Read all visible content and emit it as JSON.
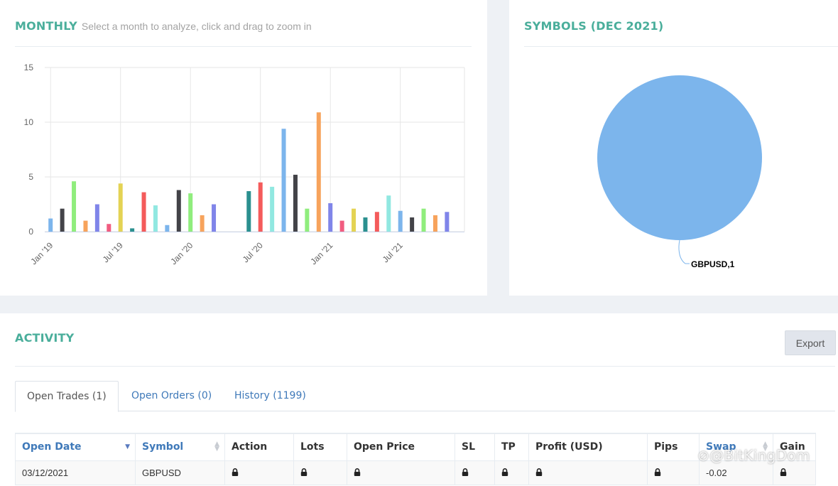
{
  "monthly": {
    "title": "MONTHLY",
    "subtitle": "Select a month to analyze, click and drag to zoom in"
  },
  "symbols": {
    "title": "SYMBOLS (DEC 2021)"
  },
  "activity": {
    "title": "ACTIVITY",
    "export_label": "Export",
    "tabs": [
      "Open Trades (1)",
      "Open Orders (0)",
      "History (1199)"
    ],
    "columns": [
      "Open Date",
      "Symbol",
      "Action",
      "Lots",
      "Open Price",
      "SL",
      "TP",
      "Profit (USD)",
      "Pips",
      "Swap",
      "Gain"
    ],
    "rows": [
      {
        "open_date": "03/12/2021",
        "symbol": "GBPUSD",
        "swap": "-0.02"
      }
    ],
    "locked_icon": "lock-icon"
  },
  "watermark": "@BitKingDom",
  "chart_data": [
    {
      "type": "bar",
      "title": "MONTHLY",
      "xlabel": "",
      "ylabel": "",
      "ylim": [
        0,
        15
      ],
      "yticks": [
        0,
        5,
        10,
        15
      ],
      "xtick_labels": [
        "Jan '19",
        "Jul '19",
        "Jan '20",
        "Jul '20",
        "Jan '21",
        "Jul '21"
      ],
      "grid": true,
      "categories": [
        "Jan '19",
        "Feb '19",
        "Mar '19",
        "Apr '19",
        "May '19",
        "Jun '19",
        "Jul '19",
        "Aug '19",
        "Sep '19",
        "Oct '19",
        "Nov '19",
        "Dec '19",
        "Jan '20",
        "Feb '20",
        "Mar '20",
        "Apr '20",
        "May '20",
        "Jun '20",
        "Jul '20",
        "Aug '20",
        "Sep '20",
        "Oct '20",
        "Nov '20",
        "Dec '20",
        "Jan '21",
        "Feb '21",
        "Mar '21",
        "Apr '21",
        "May '21",
        "Jun '21",
        "Jul '21",
        "Aug '21",
        "Sep '21",
        "Oct '21",
        "Nov '21",
        "Dec '21"
      ],
      "values": [
        1.2,
        2.1,
        4.6,
        1.0,
        2.5,
        0.7,
        4.4,
        0.3,
        3.6,
        2.4,
        0.6,
        3.8,
        3.5,
        1.5,
        2.5,
        0,
        0,
        3.7,
        4.5,
        4.1,
        9.4,
        5.2,
        2.1,
        10.9,
        2.6,
        1.0,
        2.1,
        1.3,
        1.8,
        3.3,
        1.9,
        1.3,
        2.1,
        1.5,
        1.8,
        0
      ],
      "colors": [
        "#7cb5ec",
        "#434348",
        "#90ed7d",
        "#f7a35c",
        "#8085e9",
        "#f15c80",
        "#e4d354",
        "#2b908f",
        "#f45b5b",
        "#91e8e1"
      ]
    },
    {
      "type": "pie",
      "title": "SYMBOLS (DEC 2021)",
      "slices": [
        {
          "label": "GBPUSD",
          "value": 1,
          "color": "#7cb5ec"
        }
      ],
      "data_label": "GBPUSD,1"
    }
  ]
}
